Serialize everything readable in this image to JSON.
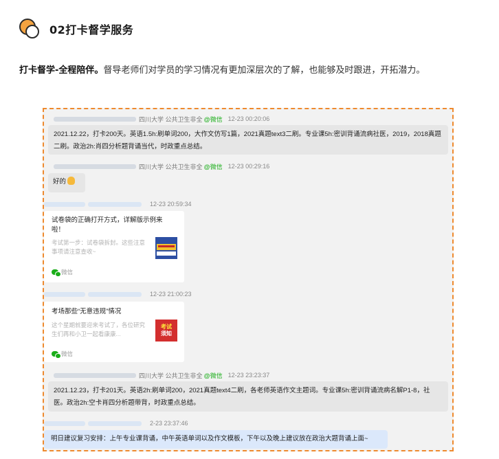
{
  "header": {
    "icon": "orange-circle-logo-icon",
    "title": "02打卡督学服务"
  },
  "intro": {
    "lead": "打卡督学-全程陪伴。",
    "text": "督导老师们对学员的学习情况有更加深层次的了解，也能够及时跟进，开拓潜力。"
  },
  "chat": {
    "messages": [
      {
        "org": "四川大学 公共卫生非全",
        "badge": "@微信",
        "time": "12-23 00:20:06",
        "text": "2021.12.22，打卡200天。英语1.5h:刷单词200，大作文仿写1篇，2021真题text3二刷。专业课5h:密训背诵流病社医，2019，2018真题二刷。政治2h:肖四分析题背诵当代，时政重点总结。"
      },
      {
        "org": "四川大学 公共卫生非全",
        "badge": "@微信",
        "time": "12-23 00:29:16",
        "text": "好的",
        "emoji": "ok-hand-emoji-icon"
      },
      {
        "time": "12-23 20:59:34",
        "card": {
          "title": "试卷袋的正确打开方式，详解版示例来啦！",
          "desc": "考试第一步：试卷袋拆封。这些注意事项请注意查收~",
          "thumb": "exam-envelope-thumbnail",
          "source": "微信"
        }
      },
      {
        "time": "12-23 21:00:23",
        "card": {
          "title": "考场那些“无意违规”情况",
          "desc": "这个星期就要迎来考试了，各位研究生们再和小卫一起看康康...",
          "thumb": "exam-notice-thumbnail",
          "thumb_text": [
            "考试",
            "须知"
          ],
          "source": "微信"
        }
      },
      {
        "org": "四川大学 公共卫生非全",
        "badge": "@微信",
        "time": "12-23 23:23:37",
        "text": "2021.12.23，打卡201天。英语2h:刷单词200，2021真题text4二刷，各老师英语作文主题词。专业课5h:密训背诵流病名解P1-8，社医。政治2h:空卡肖四分析题带背，时政重点总结。"
      },
      {
        "time": "2-23 23:37:46",
        "text": "明日建议复习安排：上午专业课背诵，中午英语单词以及作文模板，下午以及晚上建议放在政治大题背诵上面~"
      }
    ]
  },
  "colors": {
    "accent_orange": "#ee8a2e",
    "wechat_green": "#1aad19",
    "time_blue": "#3b7dd8",
    "self_bubble": "#dbe8fb"
  }
}
